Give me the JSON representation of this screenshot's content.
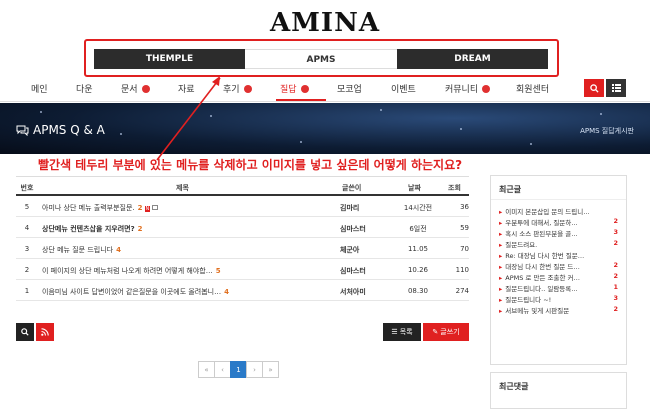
{
  "header": {
    "logo": "AMINA",
    "tabs": [
      {
        "label": "THEMPLE"
      },
      {
        "label": "APMS"
      },
      {
        "label": "DREAM"
      }
    ]
  },
  "nav": {
    "items": [
      {
        "label": "메인",
        "dot": false
      },
      {
        "label": "다운",
        "dot": false
      },
      {
        "label": "문서",
        "dot": true
      },
      {
        "label": "자료",
        "dot": false
      },
      {
        "label": "후기",
        "dot": true
      },
      {
        "label": "질답",
        "dot": true,
        "active": true
      },
      {
        "label": "모코업",
        "dot": false
      },
      {
        "label": "이벤트",
        "dot": false
      },
      {
        "label": "커뮤니티",
        "dot": true
      },
      {
        "label": "회원센터",
        "dot": false
      }
    ]
  },
  "banner": {
    "title": "APMS Q & A",
    "subtitle": "APMS 질답게시판"
  },
  "annotation": "빨간색 테두리 부분에 있는 메뉴를 삭제하고 이미지를 넣고 싶은데 어떻게 하는지요?",
  "board": {
    "columns": {
      "num": "번호",
      "title": "제목",
      "author": "글쓴이",
      "date": "날짜",
      "views": "조회"
    },
    "rows": [
      {
        "num": "5",
        "title": "아미나 상단 메뉴 출력부분질문.",
        "comments": "2",
        "author": "김마리",
        "date": "14시간전",
        "views": "36",
        "new": true
      },
      {
        "num": "4",
        "title": "상단메뉴 컨텐츠삽을 지우려면?",
        "comments": "2",
        "author": "심마스터",
        "date": "6일전",
        "views": "59",
        "bold": true
      },
      {
        "num": "3",
        "title": "상단 메뉴 질문 드립니다",
        "comments": "4",
        "author": "체군아",
        "date": "11.05",
        "views": "70"
      },
      {
        "num": "2",
        "title": "이 페이지의 상단 메뉴처럼 나오게 하려면 어떻게 해야합…",
        "comments": "5",
        "author": "심마스터",
        "date": "10.26",
        "views": "110"
      },
      {
        "num": "1",
        "title": "이음미님 사이트 답변이었어 같은질문을 이곳에도 올려봅니…",
        "comments": "4",
        "author": "서처아미",
        "date": "08.30",
        "views": "274"
      }
    ],
    "list_label": "목록",
    "write_label": "글쓰기"
  },
  "pager": {
    "first": "«",
    "prev": "‹",
    "current": "1",
    "next": "›",
    "last": "»"
  },
  "sidebar": {
    "recent_posts_title": "최근글",
    "recent_posts": [
      {
        "title": "이미지 본문삽입 문의 드립니…",
        "count": ""
      },
      {
        "title": "우분투에 대해서, 질문하…",
        "count": "2"
      },
      {
        "title": "혹시 소스 판된부분을 골…",
        "count": "3"
      },
      {
        "title": "질문드려요.",
        "count": "2"
      },
      {
        "title": "Re: 대장님 다시 한번 질문…",
        "count": ""
      },
      {
        "title": "대장님 다시 한번 질문 드…",
        "count": "2"
      },
      {
        "title": "APMS 로 만든 조출한 커…",
        "count": "2"
      },
      {
        "title": "질문드립니다.. 일람등록…",
        "count": "1"
      },
      {
        "title": "질문드립니다 ~!",
        "count": "3"
      },
      {
        "title": "서브메뉴 및게 시판질문",
        "count": "2"
      }
    ],
    "recent_comments_title": "최근댓글"
  },
  "colors": {
    "accent": "#e02020",
    "dark": "#2c2c2c",
    "link": "#2a7ac8"
  }
}
